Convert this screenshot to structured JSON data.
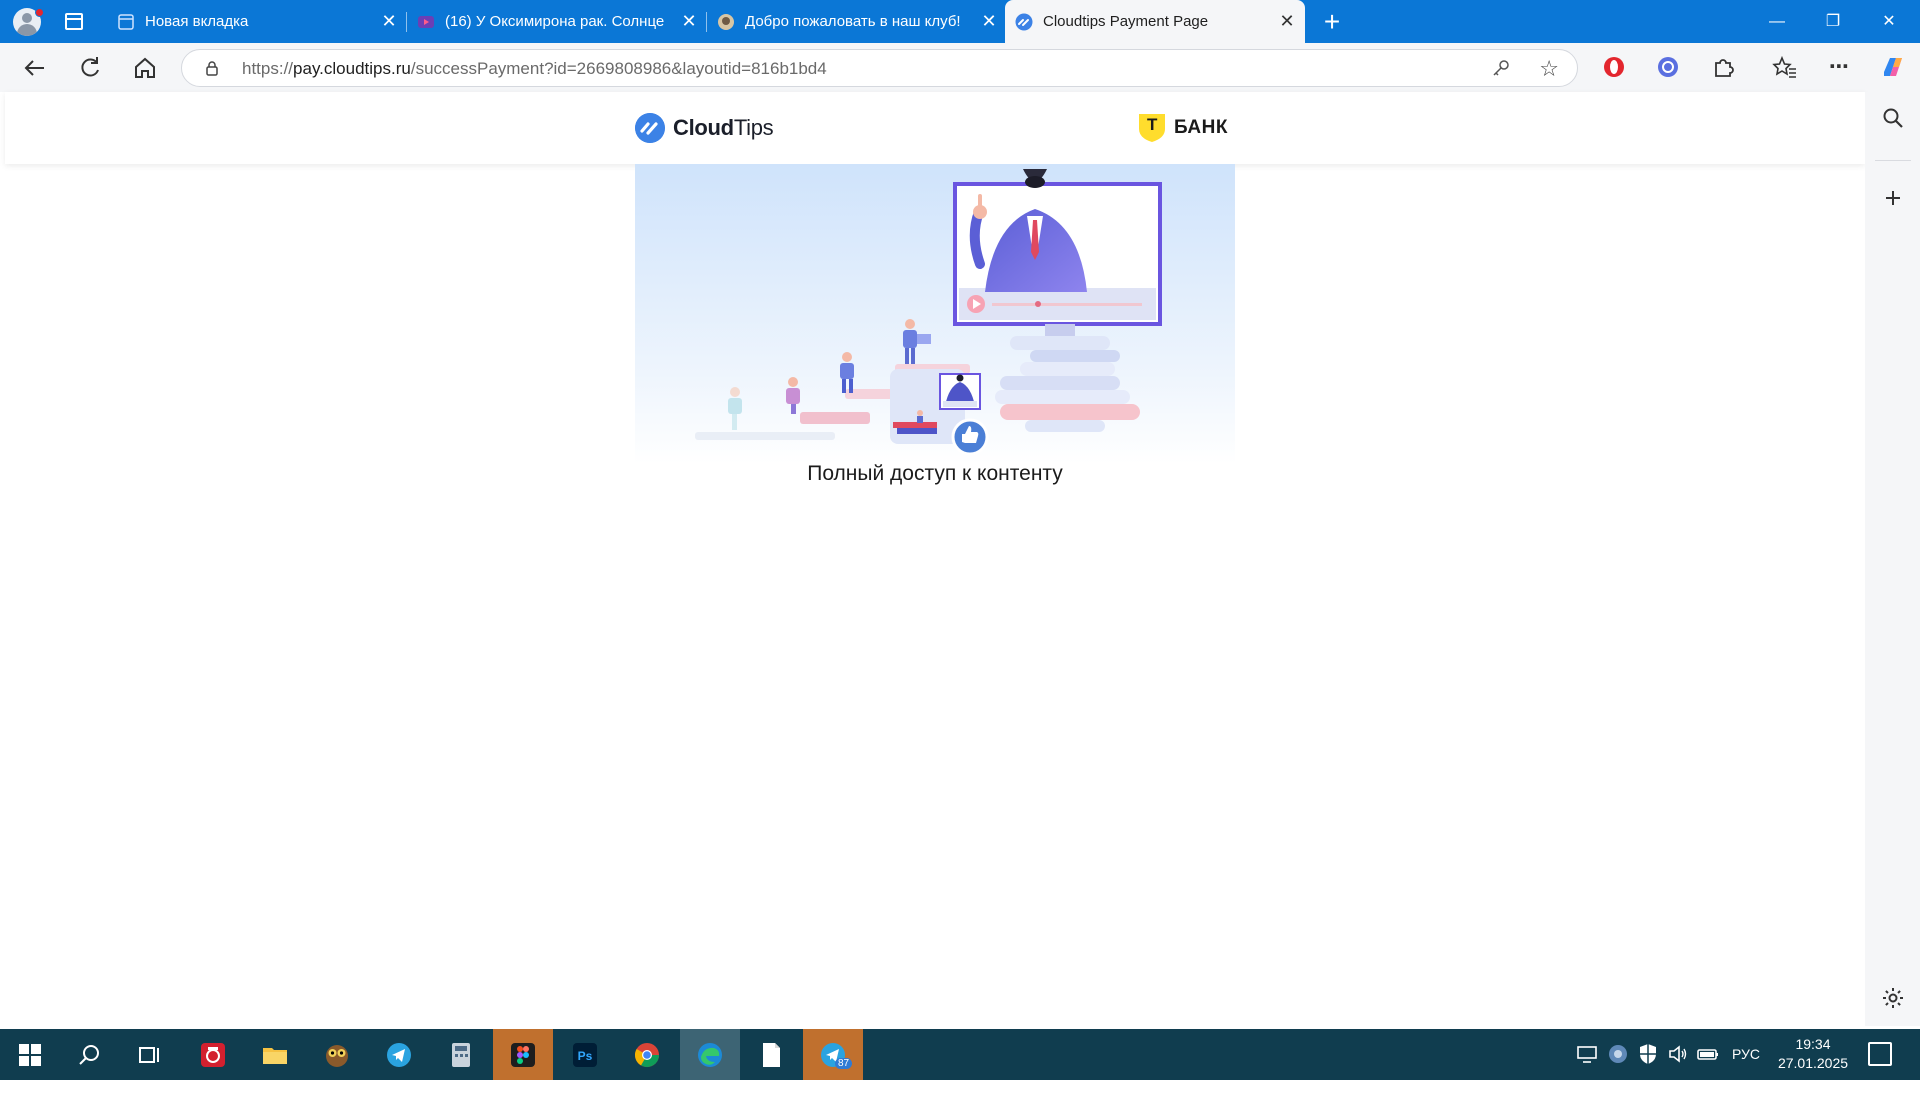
{
  "browser": {
    "tabs": [
      {
        "title": "Новая вкладка",
        "favicon": "page-icon",
        "active": false
      },
      {
        "title": "(16) У Оксимирона рак. Солнце",
        "favicon": "video-icon",
        "active": false
      },
      {
        "title": "Добро пожаловать в наш клуб!",
        "favicon": "club-icon",
        "active": false
      },
      {
        "title": "Cloudtips Payment Page",
        "favicon": "cloudtips-icon",
        "active": true
      }
    ],
    "close_glyph": "✕",
    "new_tab_glyph": "+",
    "window_controls": {
      "minimize": "—",
      "restore": "❐",
      "close": "✕"
    },
    "address": {
      "scheme": "https://",
      "domain": "pay.cloudtips.ru",
      "path": "/successPayment?id=2669808986&layoutid=816b1bd4"
    }
  },
  "page": {
    "logo_cloudtips": {
      "part1": "Cloud",
      "part2": "Tips"
    },
    "logo_tbank": {
      "mark": "Т",
      "text": "БАНК"
    },
    "caption": "Полный доступ к контенту"
  },
  "taskbar": {
    "lang": "РУС",
    "time": "19:34",
    "date": "27.01.2025",
    "telegram_badge": "87"
  },
  "colors": {
    "titlebar": "#0b77d6",
    "taskbar": "#103d4f",
    "accent_blue": "#3c82e6",
    "tbank_yellow": "#ffdd2d"
  }
}
